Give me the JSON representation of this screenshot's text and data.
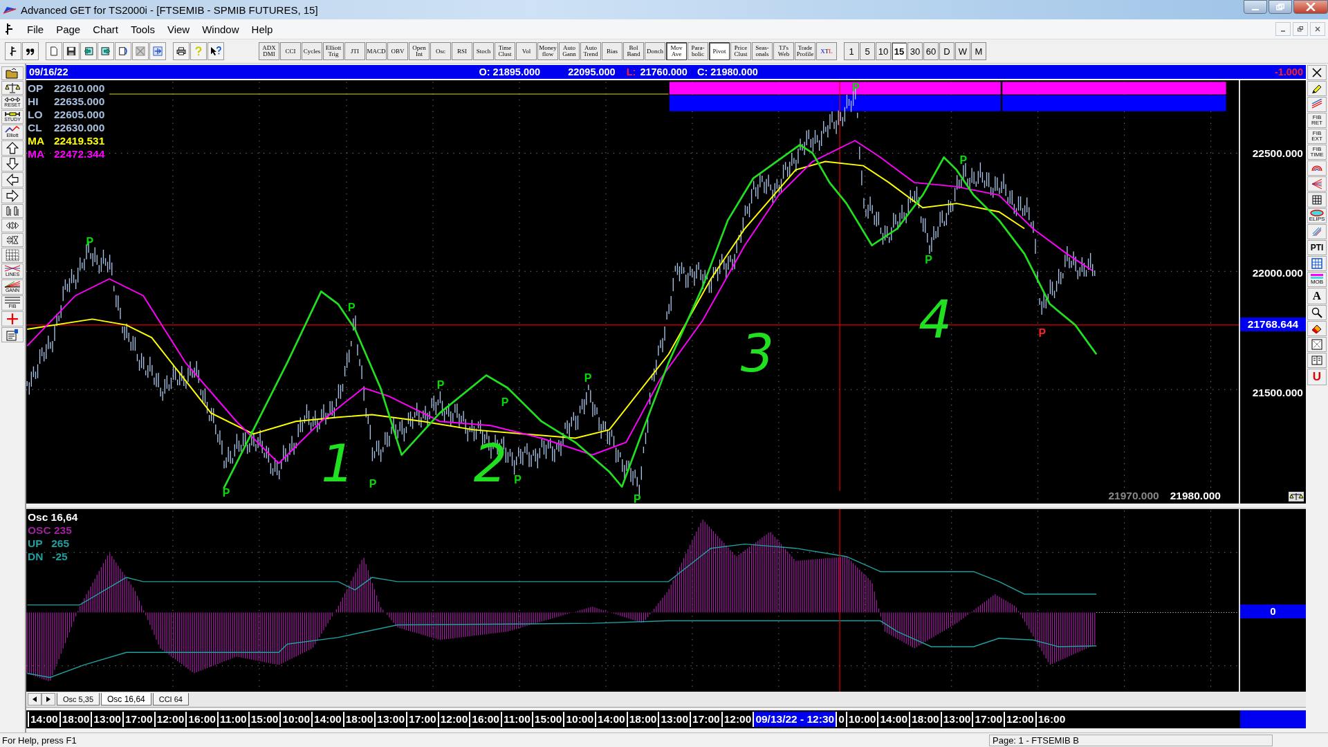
{
  "window": {
    "title": "Advanced GET for TS2000i - [FTSEMIB - SPMIB FUTURES, 15]"
  },
  "menu": [
    "File",
    "Page",
    "Chart",
    "Tools",
    "View",
    "Window",
    "Help"
  ],
  "study_buttons": [
    {
      "label": "ADX DMI",
      "selected": false
    },
    {
      "label": "CCI",
      "selected": false
    },
    {
      "label": "Cycles",
      "selected": false
    },
    {
      "label": "Elliott Trig",
      "selected": false
    },
    {
      "label": "JTI",
      "selected": false
    },
    {
      "label": "MACD",
      "selected": false
    },
    {
      "label": "OBV",
      "selected": false
    },
    {
      "label": "Open Int",
      "selected": false
    },
    {
      "label": "Osc",
      "selected": false
    },
    {
      "label": "RSI",
      "selected": false
    },
    {
      "label": "Stoch",
      "selected": false
    },
    {
      "label": "Time Clust",
      "selected": false
    },
    {
      "label": "Vol",
      "selected": false
    },
    {
      "label": "Money flow",
      "selected": false
    },
    {
      "label": "Auto Gann",
      "selected": false
    },
    {
      "label": "Auto Trend",
      "selected": false
    },
    {
      "label": "Bias",
      "selected": false
    },
    {
      "label": "Bol Band",
      "selected": false
    },
    {
      "label": "Donch",
      "selected": false
    },
    {
      "label": "Mov Ave",
      "selected": true
    },
    {
      "label": "Para-bolic",
      "selected": false
    },
    {
      "label": "Pivot",
      "selected": true
    },
    {
      "label": "Price Clust",
      "selected": false
    },
    {
      "label": "Seas-onals",
      "selected": false
    },
    {
      "label": "TJ's Web",
      "selected": false
    },
    {
      "label": "Trade Profile",
      "selected": false
    },
    {
      "label": "XTL",
      "selected": false
    }
  ],
  "period_buttons": [
    {
      "label": "1",
      "selected": false
    },
    {
      "label": "5",
      "selected": false
    },
    {
      "label": "10",
      "selected": false
    },
    {
      "label": "15",
      "selected": true
    },
    {
      "label": "30",
      "selected": false
    },
    {
      "label": "60",
      "selected": false
    },
    {
      "label": "D",
      "selected": false
    },
    {
      "label": "W",
      "selected": false
    },
    {
      "label": "M",
      "selected": false
    }
  ],
  "left_toolbar": [
    "RESET",
    "STUDY",
    "Elliott",
    "LINES",
    "GANN",
    "FIB"
  ],
  "right_toolbar": [
    "FIB RET",
    "FIB EXT",
    "FIB TIME",
    "ELIPS",
    "PTI",
    "MOB",
    "A",
    "U"
  ],
  "header": {
    "date": "09/16/22",
    "open": "O: 21895.000",
    "high": "22095.000",
    "low_label": "L:",
    "low": "21760.000",
    "close": "C: 21980.000",
    "change": "-1.000"
  },
  "price_info": [
    {
      "label": "OP",
      "value": "22610.000",
      "color": "#a8c0e0"
    },
    {
      "label": "HI",
      "value": "22635.000",
      "color": "#a8c0e0"
    },
    {
      "label": "LO",
      "value": "22605.000",
      "color": "#a8c0e0"
    },
    {
      "label": "CL",
      "value": "22630.000",
      "color": "#a8c0e0"
    },
    {
      "label": "MA",
      "value": "22419.531",
      "color": "#ffff00"
    },
    {
      "label": "MA",
      "value": "22472.344",
      "color": "#ff00ff"
    }
  ],
  "pivots": [
    {
      "label": "P",
      "color": "#00e000"
    },
    {
      "label": "P",
      "color": "#00e000"
    },
    {
      "label": "P",
      "color": "#00e000"
    },
    {
      "label": "P",
      "color": "#00e000"
    },
    {
      "label": "P",
      "color": "#00e000"
    },
    {
      "label": "P",
      "color": "#00e000"
    },
    {
      "label": "P",
      "color": "#00e000"
    },
    {
      "label": "P",
      "color": "#00e000"
    },
    {
      "label": "P",
      "color": "#00e000"
    },
    {
      "label": "P",
      "color": "#00e000"
    },
    {
      "label": "P",
      "color": "#00e000"
    },
    {
      "label": "P",
      "color": "#00e000"
    },
    {
      "label": "P",
      "color": "#ff2020"
    }
  ],
  "wave_labels": [
    "1",
    "2",
    "3",
    "4"
  ],
  "price_axis": [
    "22500.000",
    "22000.000",
    "21500.000"
  ],
  "cursor_price": "21768.644",
  "last_prices": [
    "21970.000",
    "21980.000"
  ],
  "osc_info": [
    {
      "label": "Osc 16,64",
      "color": "#ffffff"
    },
    {
      "label": "OSC 235",
      "color": "#a020a0"
    },
    {
      "label": "UP   265",
      "color": "#20a0a0"
    },
    {
      "label": "DN   -25",
      "color": "#20a0a0"
    }
  ],
  "osc_axis": "0",
  "tabs": [
    {
      "label": "Osc 5,35",
      "selected": false
    },
    {
      "label": "Osc 16,64",
      "selected": true
    },
    {
      "label": "CCI 64",
      "selected": false
    }
  ],
  "time_axis": [
    {
      "label": "14:00",
      "selected": false
    },
    {
      "label": "18:00",
      "selected": false
    },
    {
      "label": "13:00",
      "selected": false
    },
    {
      "label": "17:00",
      "selected": false
    },
    {
      "label": "12:00",
      "selected": false
    },
    {
      "label": "16:00",
      "selected": false
    },
    {
      "label": "11:00",
      "selected": false
    },
    {
      "label": "15:00",
      "selected": false
    },
    {
      "label": "10:00",
      "selected": false
    },
    {
      "label": "14:00",
      "selected": false
    },
    {
      "label": "18:00",
      "selected": false
    },
    {
      "label": "13:00",
      "selected": false
    },
    {
      "label": "17:00",
      "selected": false
    },
    {
      "label": "12:00",
      "selected": false
    },
    {
      "label": "16:00",
      "selected": false
    },
    {
      "label": "11:00",
      "selected": false
    },
    {
      "label": "15:00",
      "selected": false
    },
    {
      "label": "10:00",
      "selected": false
    },
    {
      "label": "14:00",
      "selected": false
    },
    {
      "label": "18:00",
      "selected": false
    },
    {
      "label": "13:00",
      "selected": false
    },
    {
      "label": "17:00",
      "selected": false
    },
    {
      "label": "12:00",
      "selected": false
    },
    {
      "label": "09/13/22 - 12:30",
      "selected": true
    },
    {
      "label": "0",
      "selected": false
    },
    {
      "label": "10:00",
      "selected": false
    },
    {
      "label": "14:00",
      "selected": false
    },
    {
      "label": "18:00",
      "selected": false
    },
    {
      "label": "13:00",
      "selected": false
    },
    {
      "label": "17:00",
      "selected": false
    },
    {
      "label": "12:00",
      "selected": false
    },
    {
      "label": "16:00",
      "selected": false
    }
  ],
  "status_bar": {
    "help": "For Help, press F1",
    "page": "Page: 1 - FTSEMIB B"
  }
}
